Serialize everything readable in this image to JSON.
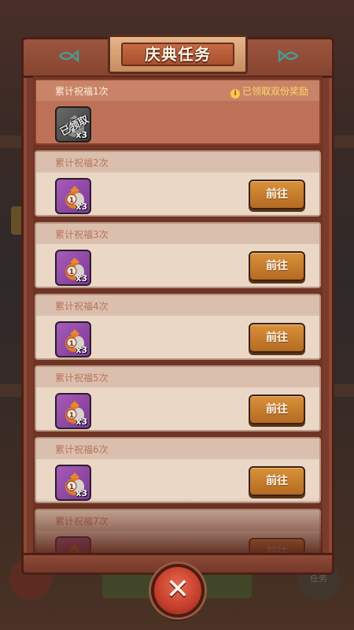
{
  "title": "庆典任务",
  "icons": {
    "fish_left": "fish-icon",
    "fish_right": "fish-icon",
    "info": "info-icon",
    "close": "close-icon"
  },
  "background": {
    "right_button_label": "任务"
  },
  "tasks": [
    {
      "label": "累计祝福1次",
      "status": "claimed",
      "note": "已领取双份奖励",
      "reward_count": "x3",
      "reward_stamp": "已领取",
      "button": ""
    },
    {
      "label": "累计祝福2次",
      "status": "open",
      "reward_count": "x3",
      "button": "前往"
    },
    {
      "label": "累计祝福3次",
      "status": "open",
      "reward_count": "x3",
      "button": "前往"
    },
    {
      "label": "累计祝福4次",
      "status": "open",
      "reward_count": "x3",
      "button": "前往"
    },
    {
      "label": "累计祝福5次",
      "status": "open",
      "reward_count": "x3",
      "button": "前往"
    },
    {
      "label": "累计祝福6次",
      "status": "open",
      "reward_count": "x3",
      "button": "前往"
    },
    {
      "label": "累计祝福7次",
      "status": "open",
      "reward_count": "x3",
      "button": "前往"
    }
  ],
  "colors": {
    "frame": "#7a3b2c",
    "card": "#ead7c6",
    "claimed_card": "#bd7258",
    "go_button": "#c67c2c",
    "reward_bg": "#8e47a6",
    "note": "#ffd86a"
  }
}
